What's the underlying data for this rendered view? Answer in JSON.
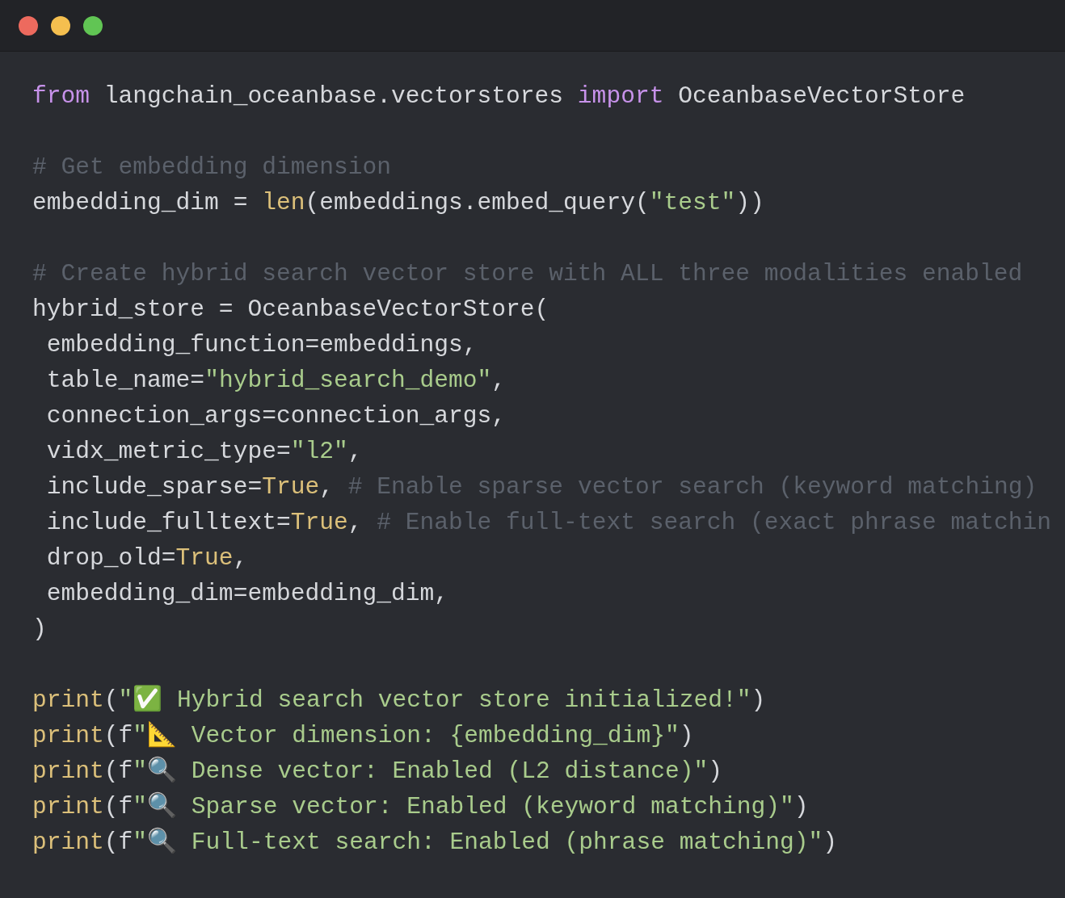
{
  "window_controls": [
    {
      "color": "#ed6a5e"
    },
    {
      "color": "#f5bf4f"
    },
    {
      "color": "#61c554"
    }
  ],
  "code_blocks": [
    [
      [
        {
          "kind": "keyword",
          "text": "from"
        },
        {
          "kind": "plain",
          "text": " langchain_oceanbase.vectorstores "
        },
        {
          "kind": "keyword",
          "text": "import"
        },
        {
          "kind": "plain",
          "text": " OceanbaseVectorStore"
        }
      ]
    ],
    [
      [
        {
          "kind": "comment",
          "text": "# Get embedding dimension"
        }
      ],
      [
        {
          "kind": "plain",
          "text": "embedding_dim = "
        },
        {
          "kind": "builtin",
          "text": "len"
        },
        {
          "kind": "plain",
          "text": "(embeddings.embed_query("
        },
        {
          "kind": "string",
          "text": "\"test\""
        },
        {
          "kind": "plain",
          "text": "))"
        }
      ]
    ],
    [
      [
        {
          "kind": "comment",
          "text": "# Create hybrid search vector store with ALL three modalities enabled"
        }
      ],
      [
        {
          "kind": "plain",
          "text": "hybrid_store = OceanbaseVectorStore("
        }
      ],
      [
        {
          "kind": "plain",
          "text": " embedding_function=embeddings,"
        }
      ],
      [
        {
          "kind": "plain",
          "text": " table_name="
        },
        {
          "kind": "string",
          "text": "\"hybrid_search_demo\""
        },
        {
          "kind": "plain",
          "text": ","
        }
      ],
      [
        {
          "kind": "plain",
          "text": " connection_args=connection_args,"
        }
      ],
      [
        {
          "kind": "plain",
          "text": " vidx_metric_type="
        },
        {
          "kind": "string",
          "text": "\"l2\""
        },
        {
          "kind": "plain",
          "text": ","
        }
      ],
      [
        {
          "kind": "plain",
          "text": " include_sparse="
        },
        {
          "kind": "builtin",
          "text": "True"
        },
        {
          "kind": "plain",
          "text": ", "
        },
        {
          "kind": "comment",
          "text": "# Enable sparse vector search (keyword matching)"
        }
      ],
      [
        {
          "kind": "plain",
          "text": " include_fulltext="
        },
        {
          "kind": "builtin",
          "text": "True"
        },
        {
          "kind": "plain",
          "text": ", "
        },
        {
          "kind": "comment",
          "text": "# Enable full-text search (exact phrase matchin"
        }
      ],
      [
        {
          "kind": "plain",
          "text": " drop_old="
        },
        {
          "kind": "builtin",
          "text": "True"
        },
        {
          "kind": "plain",
          "text": ","
        }
      ],
      [
        {
          "kind": "plain",
          "text": " embedding_dim=embedding_dim,"
        }
      ],
      [
        {
          "kind": "plain",
          "text": ")"
        }
      ]
    ],
    [
      [
        {
          "kind": "builtin",
          "text": "print"
        },
        {
          "kind": "plain",
          "text": "("
        },
        {
          "kind": "string",
          "text": "\"✅ Hybrid search vector store initialized!\""
        },
        {
          "kind": "plain",
          "text": ")"
        }
      ],
      [
        {
          "kind": "builtin",
          "text": "print"
        },
        {
          "kind": "plain",
          "text": "(f"
        },
        {
          "kind": "string",
          "text": "\"📐 Vector dimension: {embedding_dim}\""
        },
        {
          "kind": "plain",
          "text": ")"
        }
      ],
      [
        {
          "kind": "builtin",
          "text": "print"
        },
        {
          "kind": "plain",
          "text": "(f"
        },
        {
          "kind": "string",
          "text": "\"🔍 Dense vector: Enabled (L2 distance)\""
        },
        {
          "kind": "plain",
          "text": ")"
        }
      ],
      [
        {
          "kind": "builtin",
          "text": "print"
        },
        {
          "kind": "plain",
          "text": "(f"
        },
        {
          "kind": "string",
          "text": "\"🔍 Sparse vector: Enabled (keyword matching)\""
        },
        {
          "kind": "plain",
          "text": ")"
        }
      ],
      [
        {
          "kind": "builtin",
          "text": "print"
        },
        {
          "kind": "plain",
          "text": "(f"
        },
        {
          "kind": "string",
          "text": "\"🔍 Full-text search: Enabled (phrase matching)\""
        },
        {
          "kind": "plain",
          "text": ")"
        }
      ]
    ]
  ]
}
